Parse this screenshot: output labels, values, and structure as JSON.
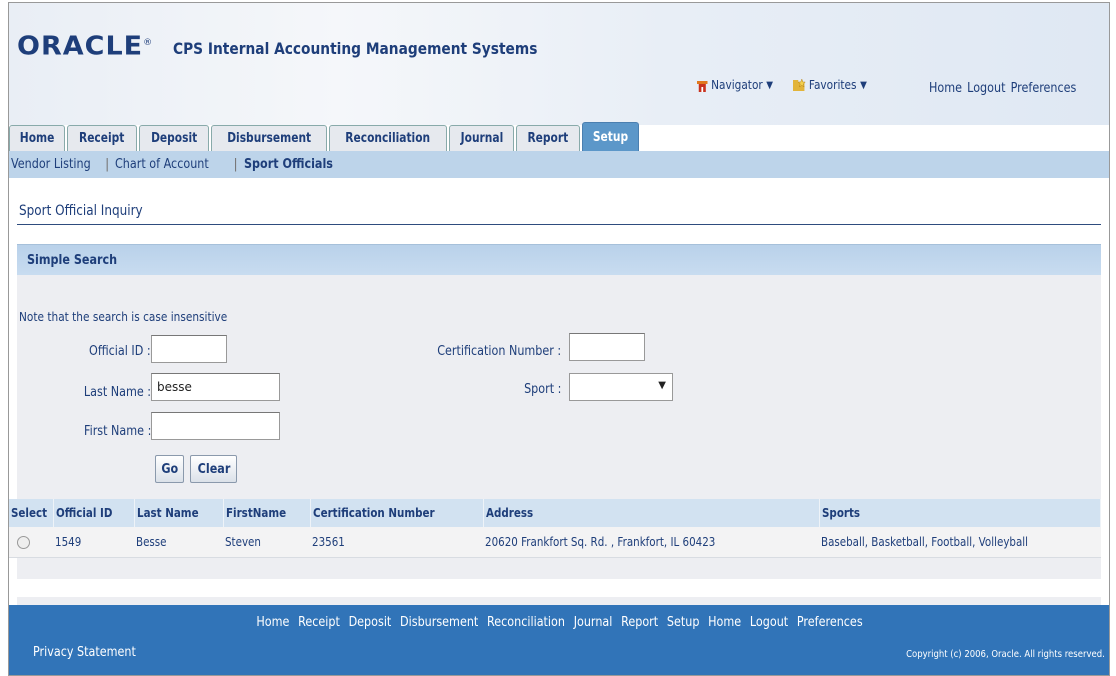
{
  "brand": {
    "logo": "ORACLE",
    "app_title": "CPS Internal Accounting Management Systems"
  },
  "global_menu": {
    "navigator": "Navigator",
    "favorites": "Favorites"
  },
  "top_links": [
    "Home",
    "Logout",
    "Preferences"
  ],
  "tabs": [
    {
      "label": "Home"
    },
    {
      "label": "Receipt"
    },
    {
      "label": "Deposit"
    },
    {
      "label": "Disbursement"
    },
    {
      "label": "Reconciliation"
    },
    {
      "label": "Journal"
    },
    {
      "label": "Report"
    },
    {
      "label": "Setup",
      "active": true
    }
  ],
  "subnav": {
    "items": [
      "Vendor Listing",
      "Chart of Account",
      "Sport Officials"
    ],
    "current": "Sport Officials"
  },
  "page_title": "Sport Official Inquiry",
  "search": {
    "header": "Simple Search",
    "note": "Note that the search is case insensitive",
    "official_id_label": "Official ID :",
    "official_id_value": "",
    "last_name_label": "Last Name :",
    "last_name_value": "besse",
    "first_name_label": "First Name :",
    "first_name_value": "",
    "cert_label": "Certification Number :",
    "cert_value": "",
    "sport_label": "Sport :",
    "sport_value": "",
    "go_label": "Go",
    "clear_label": "Clear"
  },
  "results": {
    "columns": [
      "Select",
      "Official ID",
      "Last Name",
      "FirstName",
      "Certification Number",
      "Address",
      "Sports"
    ],
    "rows": [
      {
        "official_id": "1549",
        "last_name": "Besse",
        "first_name": "Steven",
        "cert": "23561",
        "address": "20620 Frankfort Sq. Rd. , Frankfort, IL 60423",
        "sports": "Baseball, Basketball, Football, Volleyball"
      }
    ]
  },
  "footer": {
    "links": [
      "Home",
      "Receipt",
      "Deposit",
      "Disbursement",
      "Reconciliation",
      "Journal",
      "Report",
      "Setup",
      "Home",
      "Logout",
      "Preferences"
    ],
    "privacy": "Privacy Statement",
    "copyright": "Copyright (c) 2006, Oracle. All rights reserved."
  },
  "colors": {
    "brand_blue": "#1e3e7a",
    "active_tab": "#5c97c9",
    "footer": "#3174b8",
    "subnav": "#bdd4ea"
  }
}
